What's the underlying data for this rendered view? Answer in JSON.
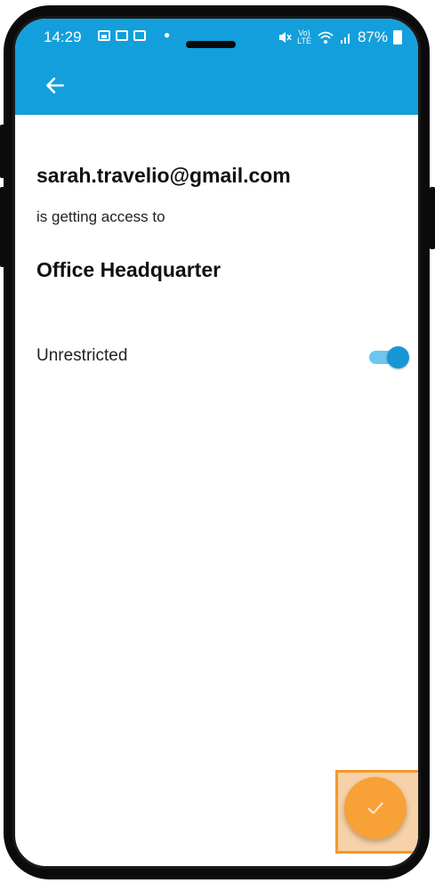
{
  "status_bar": {
    "time": "14:29",
    "battery_percent": "87%",
    "network_label_top": "Vo)",
    "network_label_bottom": "LTE",
    "icons": [
      "gallery-icon",
      "mail-icon",
      "mail-icon",
      "mute-icon",
      "wifi-icon",
      "signal-icon",
      "battery-icon"
    ]
  },
  "app_bar": {
    "color": "#139fdb",
    "back_icon": "arrow-left-icon"
  },
  "main": {
    "email": "sarah.travelio@gmail.com",
    "subtitle": "is getting access to",
    "location": "Office Headquarter",
    "restriction_label": "Unrestricted",
    "restriction_on": true
  },
  "fab": {
    "icon": "check-icon",
    "color": "#f7a136",
    "highlight_color": "#f39a2c"
  }
}
